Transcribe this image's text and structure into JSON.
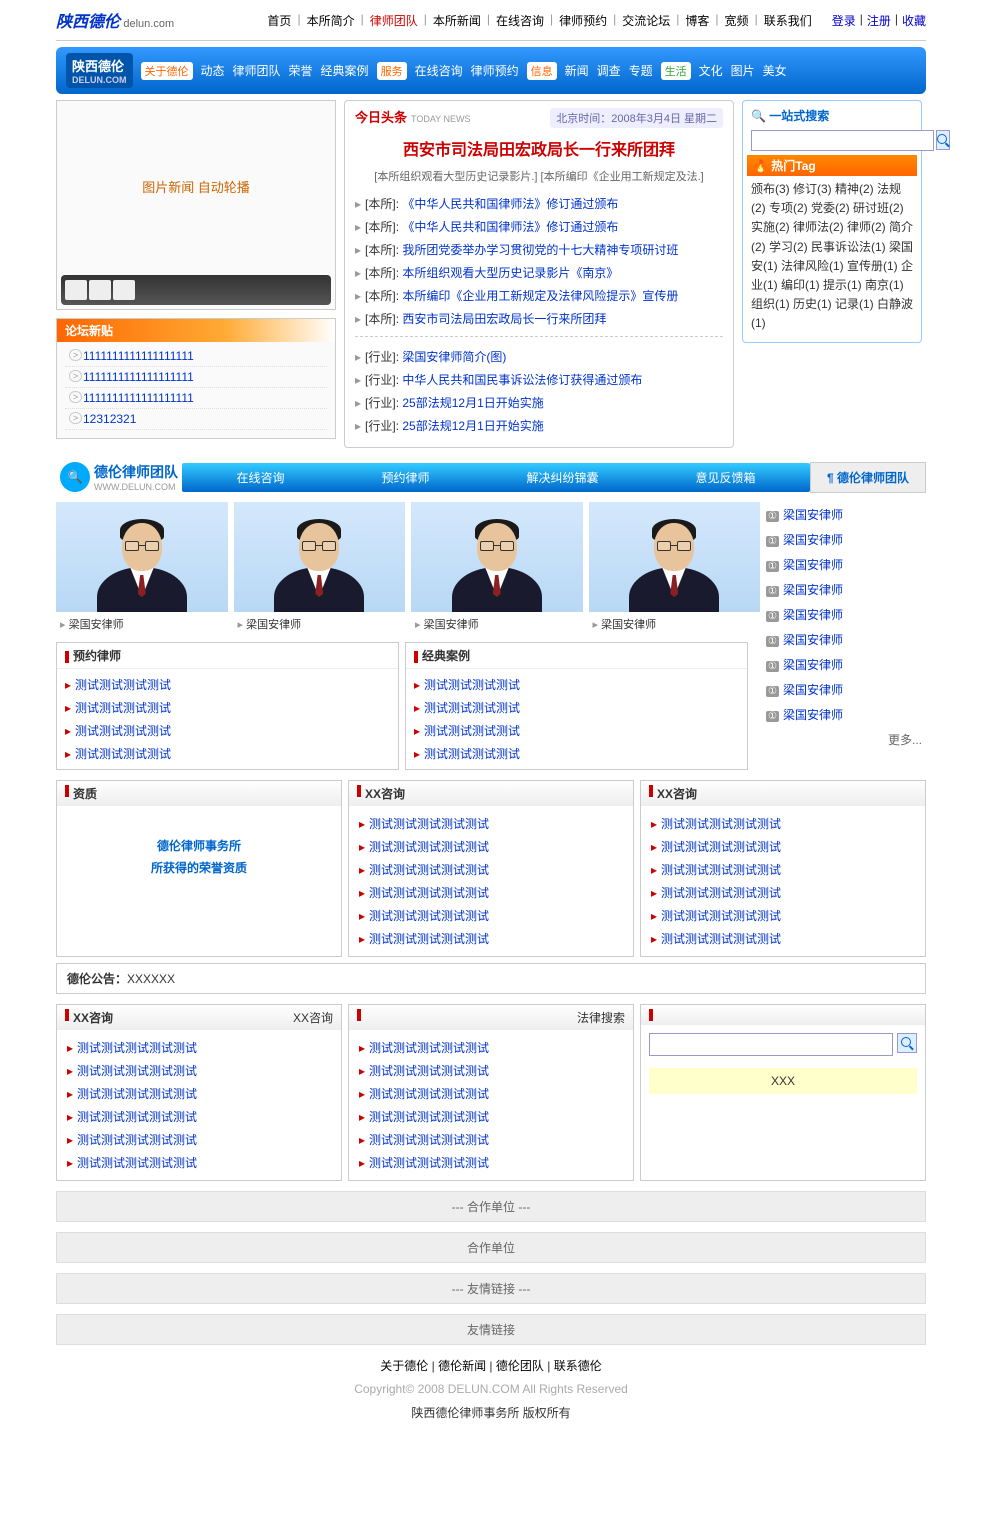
{
  "header": {
    "logo": "陕西德伦",
    "domain": "delun.com",
    "nav": [
      "首页",
      "本所简介",
      "律师团队",
      "本所新闻",
      "在线咨询",
      "律师预约",
      "交流论坛",
      "博客",
      "宽频",
      "联系我们"
    ],
    "active_index": 2,
    "right": [
      "登录",
      "注册",
      "收藏"
    ]
  },
  "blue_nav": {
    "brand": "陕西德伦",
    "brand_sub": "DELUN.COM",
    "groups": [
      {
        "label": "关于德伦",
        "class": "lbl-orange",
        "items": [
          "动态",
          "律师团队",
          "荣誉",
          "经典案例"
        ]
      },
      {
        "label": "服务",
        "class": "lbl-orange",
        "items": [
          "在线咨询",
          "律师预约"
        ]
      },
      {
        "label": "信息",
        "class": "lbl-orange",
        "items": [
          "新闻",
          "调查",
          "专题"
        ]
      },
      {
        "label": "生活",
        "class": "lbl-green",
        "items": [
          "文化",
          "图片",
          "美女"
        ]
      }
    ]
  },
  "pic_news": "图片新闻 自动轮播",
  "forum": {
    "title": "论坛新贴",
    "items": [
      "1111111111111111111",
      "1111111111111111111",
      "1111111111111111111",
      "12312321"
    ]
  },
  "today_news": {
    "label": "今日头条",
    "label_en": "TODAY NEWS",
    "date": "北京时间：2008年3月4日 星期二",
    "headline": "西安市司法局田宏政局长一行来所团拜",
    "sub": "[本所组织观看大型历史记录影片.] [本所编印《企业用工新规定及法.]",
    "list1": [
      {
        "cat": "[本所]",
        "title": "《中华人民共和国律师法》修订通过颁布"
      },
      {
        "cat": "[本所]",
        "title": "《中华人民共和国律师法》修订通过颁布"
      },
      {
        "cat": "[本所]",
        "title": "我所团党委举办学习贯彻党的十七大精神专项研讨班"
      },
      {
        "cat": "[本所]",
        "title": "本所组织观看大型历史记录影片《南京》"
      },
      {
        "cat": "[本所]",
        "title": "本所编印《企业用工新规定及法律风险提示》宣传册"
      },
      {
        "cat": "[本所]",
        "title": "西安市司法局田宏政局长一行来所团拜"
      }
    ],
    "list2": [
      {
        "cat": "[行业]",
        "title": "梁国安律师简介(图)"
      },
      {
        "cat": "[行业]",
        "title": "中华人民共和国民事诉讼法修订获得通过颁布"
      },
      {
        "cat": "[行业]",
        "title": "25部法规12月1日开始实施"
      },
      {
        "cat": "[行业]",
        "title": "25部法规12月1日开始实施"
      }
    ]
  },
  "search": {
    "title": "一站式搜索",
    "hot_title": "热门Tag",
    "tags": "颁布(3) 修订(3) 精神(2) 法规(2) 专项(2) 党委(2) 研讨班(2) 实施(2) 律师法(2) 律师(2) 简介(2) 学习(2) 民事诉讼法(1) 梁国安(1) 法律风险(1) 宣传册(1) 企业(1) 编印(1) 提示(1) 南京(1) 组织(1) 历史(1) 记录(1) 白静波(1)"
  },
  "team": {
    "logo": "德伦律师团队",
    "logo_sub": "WWW.DELUN.COM",
    "nav": [
      "在线咨询",
      "预约律师",
      "解决纠纷锦囊",
      "意见反馈箱"
    ],
    "title_right": "德伦律师团队",
    "portraits": [
      "梁国安律师",
      "梁国安律师",
      "梁国安律师",
      "梁国安律师"
    ],
    "sidebar_lawyers": [
      "梁国安律师",
      "梁国安律师",
      "梁国安律师",
      "梁国安律师",
      "梁国安律师",
      "梁国安律师",
      "梁国安律师",
      "梁国安律师",
      "梁国安律师"
    ],
    "more": "更多...",
    "appt": {
      "title": "预约律师",
      "items": [
        "测试测试测试测试",
        "测试测试测试测试",
        "测试测试测试测试",
        "测试测试测试测试"
      ]
    },
    "cases": {
      "title": "经典案例",
      "items": [
        "测试测试测试测试",
        "测试测试测试测试",
        "测试测试测试测试",
        "测试测试测试测试"
      ]
    }
  },
  "lower": {
    "honor": {
      "title": "资质",
      "text1": "德伦律师事务所",
      "text2": "所获得的荣誉资质"
    },
    "col2": {
      "title": "XX咨询",
      "items": [
        "测试测试测试测试测试",
        "测试测试测试测试测试",
        "测试测试测试测试测试",
        "测试测试测试测试测试",
        "测试测试测试测试测试",
        "测试测试测试测试测试"
      ]
    },
    "col3": {
      "title": "XX咨询",
      "items": [
        "测试测试测试测试测试",
        "测试测试测试测试测试",
        "测试测试测试测试测试",
        "测试测试测试测试测试",
        "测试测试测试测试测试",
        "测试测试测试测试测试"
      ]
    },
    "notice_label": "德伦公告：",
    "notice": "XXXXXX"
  },
  "lower2": {
    "col1": {
      "title": "XX咨询",
      "right": "XX咨询",
      "items": [
        "测试测试测试测试测试",
        "测试测试测试测试测试",
        "测试测试测试测试测试",
        "测试测试测试测试测试",
        "测试测试测试测试测试",
        "测试测试测试测试测试"
      ]
    },
    "col2": {
      "title": "",
      "right": "法律搜索",
      "items": [
        "测试测试测试测试测试",
        "测试测试测试测试测试",
        "测试测试测试测试测试",
        "测试测试测试测试测试",
        "测试测试测试测试测试",
        "测试测试测试测试测试"
      ]
    },
    "col3": {
      "title": "",
      "xxx": "XXX"
    }
  },
  "footer": {
    "partners_label": "--- 合作单位 ---",
    "partners": "合作单位",
    "links_label": "--- 友情链接 ---",
    "links": "友情链接",
    "bottom_links": [
      "关于德伦",
      "德伦新闻",
      "德伦团队",
      "联系德伦"
    ],
    "copyright": "Copyright© 2008 DELUN.COM All Rights Reserved",
    "copyright2": "陕西德伦律师事务所 版权所有"
  }
}
